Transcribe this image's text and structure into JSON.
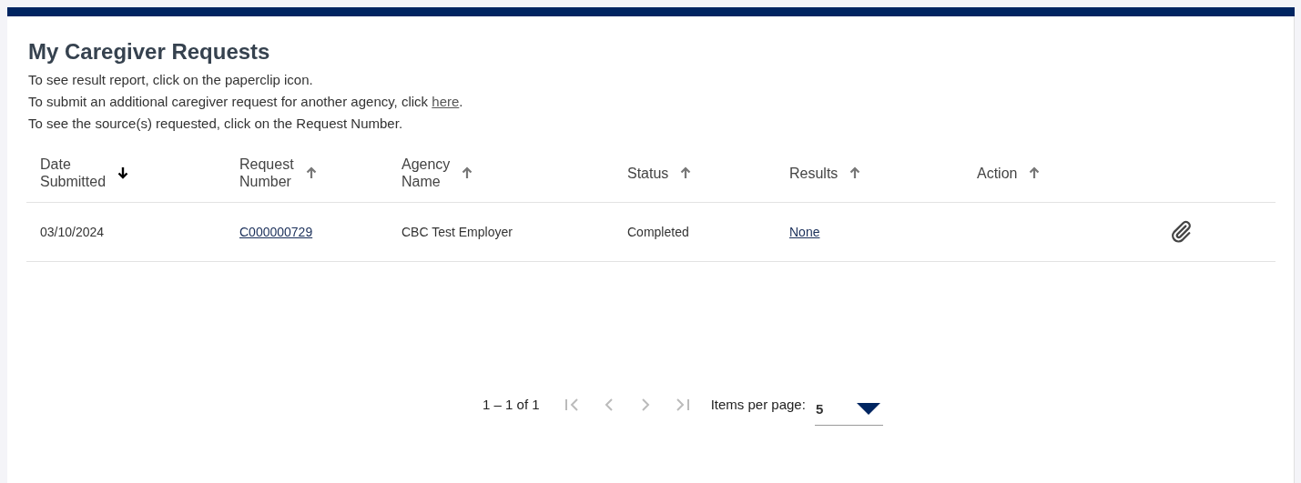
{
  "title": "My Caregiver Requests",
  "instructions": [
    {
      "text": "To see result report, click on the paperclip icon."
    },
    {
      "text": "To submit an additional caregiver request for another agency, click ",
      "link": "here",
      "after": "."
    },
    {
      "text": "To see the source(s) requested, click on the Request Number."
    }
  ],
  "table": {
    "columns": [
      {
        "label": [
          "Date",
          "Submitted"
        ],
        "descending": true,
        "active": true
      },
      {
        "label": [
          "Request",
          "Number"
        ],
        "descending": false,
        "active": false
      },
      {
        "label": [
          "Agency",
          "Name"
        ],
        "descending": false,
        "active": false
      },
      {
        "label": [
          "Status"
        ],
        "descending": false,
        "active": false
      },
      {
        "label": [
          "Results"
        ],
        "descending": false,
        "active": false
      },
      {
        "label": [
          "Action"
        ],
        "descending": false,
        "active": false
      }
    ],
    "rows": [
      {
        "date": "03/10/2024",
        "request_number": "C000000729",
        "agency": "CBC Test Employer",
        "status": "Completed",
        "results": "None",
        "attachment": true
      }
    ]
  },
  "paginator": {
    "range": "1 – 1 of 1",
    "first_disabled": true,
    "previous_disabled": true,
    "next_disabled": true,
    "last_disabled": true,
    "items_label": "Items per page:",
    "page_size": "5"
  }
}
